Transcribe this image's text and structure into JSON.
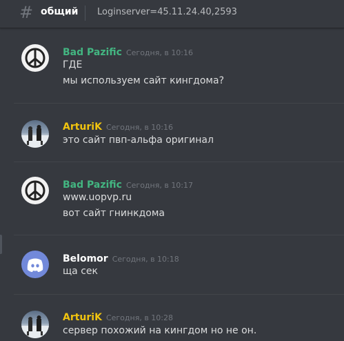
{
  "header": {
    "hash_symbol": "#",
    "channel_name": "общий",
    "topic": "Loginserver=45.11.24.40,2593"
  },
  "colors": {
    "background": "#36393f",
    "username_green": "#43b581",
    "username_gold": "#f1c40f",
    "username_white": "#ffffff",
    "timestamp": "#72767d",
    "text": "#dcddde"
  },
  "messages": [
    {
      "author": "Bad Pazific",
      "author_color": "#43b581",
      "avatar_icon": "peace-sign-icon",
      "timestamp": "Сегодня, в 10:16",
      "lines": [
        "ГДЕ",
        "мы используем сайт кингдома?"
      ]
    },
    {
      "author": "ArturiK",
      "author_color": "#f1c40f",
      "avatar_icon": "photo-avatar",
      "timestamp": "Сегодня, в 10:16",
      "lines": [
        "это сайт пвп-альфа оригинал"
      ]
    },
    {
      "author": "Bad Pazific",
      "author_color": "#43b581",
      "avatar_icon": "peace-sign-icon",
      "timestamp": "Сегодня, в 10:17",
      "lines": [
        "www.uopvp.ru",
        "вот сайт гнинкдома"
      ]
    },
    {
      "author": "Belomor",
      "author_color": "#ffffff",
      "avatar_icon": "discord-logo-icon",
      "timestamp": "Сегодня, в 10:18",
      "lines": [
        "ща сек"
      ]
    },
    {
      "author": "ArturiK",
      "author_color": "#f1c40f",
      "avatar_icon": "photo-avatar",
      "timestamp": "Сегодня, в 10:28",
      "lines": [
        "сервер похожий на кингдом но не он."
      ]
    }
  ]
}
